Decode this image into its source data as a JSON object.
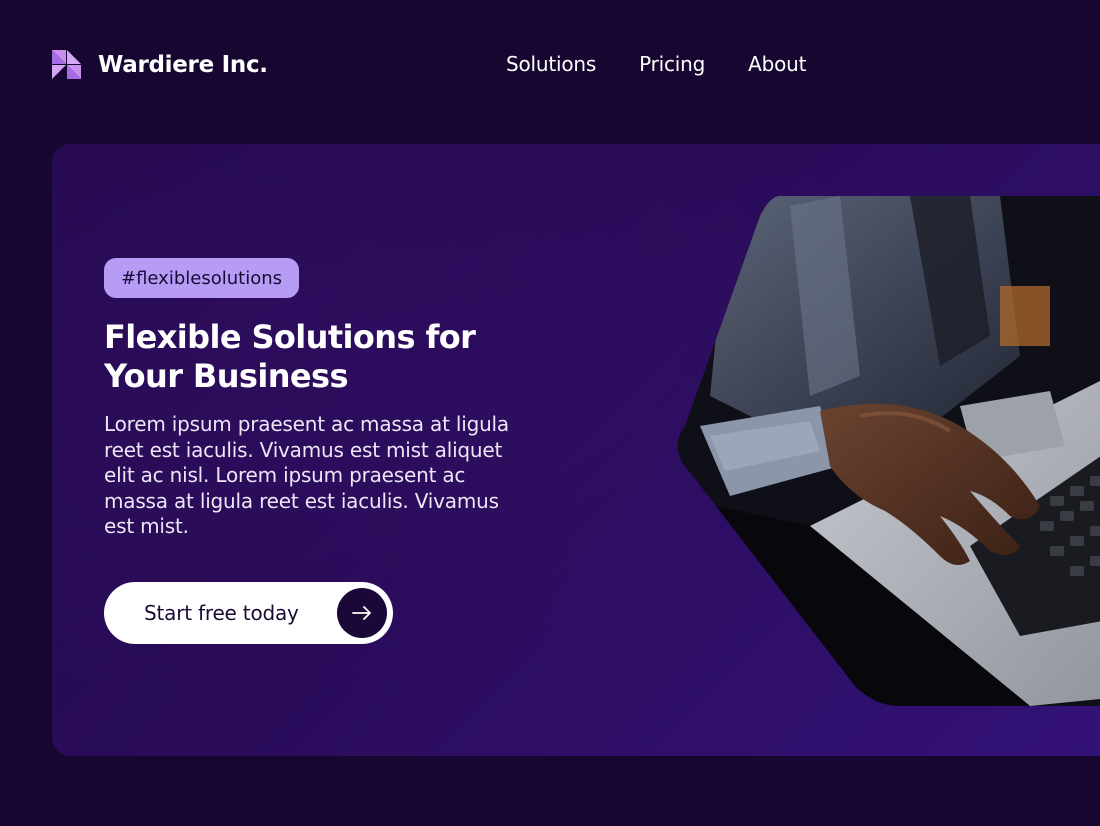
{
  "header": {
    "brand_name": "Wardiere Inc.",
    "logo_icon": "triangle-grid-logo-icon",
    "nav": [
      {
        "label": "Solutions"
      },
      {
        "label": "Pricing"
      },
      {
        "label": "About"
      }
    ]
  },
  "hero": {
    "tag": "#flexiblesolutions",
    "headline": "Flexible Solutions for Your Business",
    "description": "Lorem ipsum praesent ac massa at ligula reet est iaculis. Vivamus est mist aliquet elit ac nisl. Lorem ipsum praesent ac massa at ligula reet est iaculis. Vivamus est mist.",
    "cta_label": "Start free today",
    "cta_icon": "arrow-right-icon",
    "image": "laptop-typing-hands-photo"
  },
  "colors": {
    "background": "#17062f",
    "hero_panel": "#2a0c5a",
    "tag_bg": "#b79cf6",
    "accent_logo": "#c99bf2",
    "cta_bg": "#ffffff",
    "cta_icon_bg": "#1a0838"
  }
}
